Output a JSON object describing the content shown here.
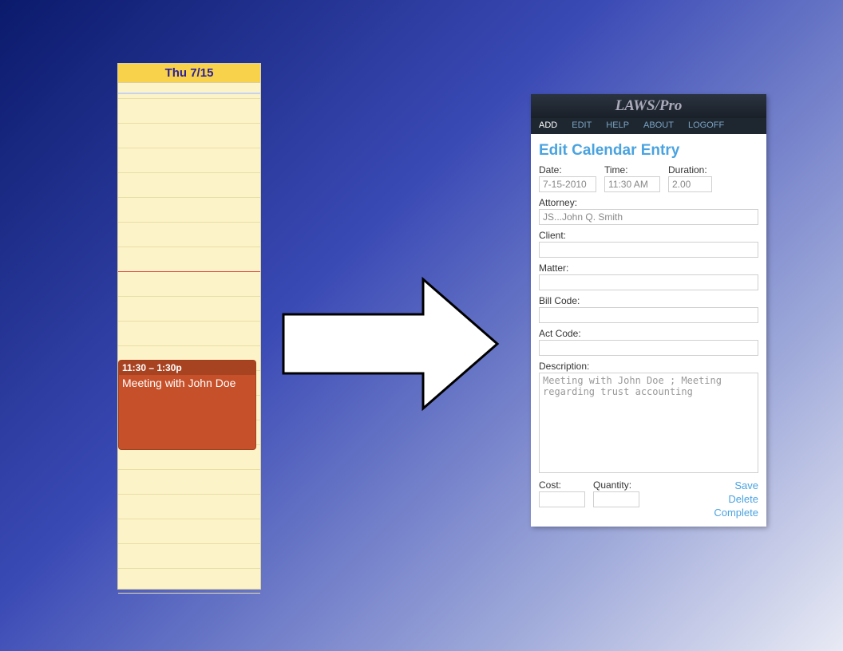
{
  "calendar": {
    "day_header": "Thu 7/15",
    "event": {
      "time_range": "11:30 – 1:30p",
      "title": "Meeting with John Doe"
    }
  },
  "panel": {
    "app_title": "LAWS/Pro",
    "menu": {
      "add": "ADD",
      "edit": "EDIT",
      "help": "HELP",
      "about": "ABOUT",
      "logoff": "LOGOFF"
    },
    "heading": "Edit Calendar Entry",
    "labels": {
      "date": "Date:",
      "time": "Time:",
      "duration": "Duration:",
      "attorney": "Attorney:",
      "client": "Client:",
      "matter": "Matter:",
      "billcode": "Bill Code:",
      "actcode": "Act Code:",
      "description": "Description:",
      "cost": "Cost:",
      "quantity": "Quantity:"
    },
    "values": {
      "date": "7-15-2010",
      "time": "11:30 AM",
      "duration": "2.00",
      "attorney": "JS...John Q. Smith",
      "client": "",
      "matter": "",
      "billcode": "",
      "actcode": "",
      "description": "Meeting with John Doe ; Meeting regarding trust accounting",
      "cost": "",
      "quantity": ""
    },
    "actions": {
      "save": "Save",
      "delete": "Delete",
      "complete": "Complete"
    }
  }
}
